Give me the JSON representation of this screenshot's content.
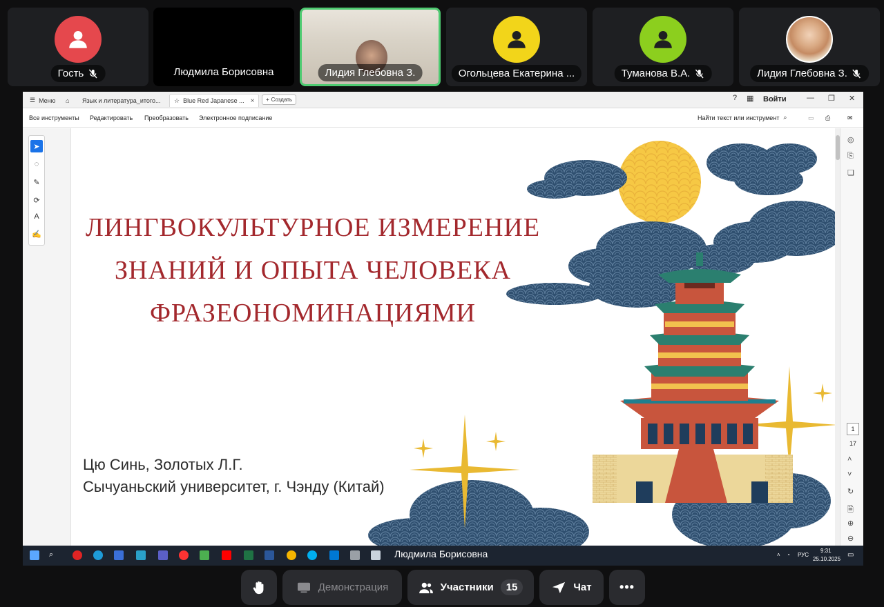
{
  "participants": [
    {
      "name": "Гость",
      "muted": true,
      "avatar": "person-icon",
      "color": "#e5484d"
    },
    {
      "name": "Людмила Борисовна",
      "muted": false,
      "avatar": "none",
      "color": "#000000"
    },
    {
      "name": "Лидия Глебовна З.",
      "muted": false,
      "avatar": "camera-video",
      "active": true
    },
    {
      "name": "Огольцева Екатерина ...",
      "muted": false,
      "avatar": "person-icon",
      "color": "#f2d51a"
    },
    {
      "name": "Туманова В.А.",
      "muted": true,
      "avatar": "person-icon",
      "color": "#8ccf1e"
    },
    {
      "name": "Лидия Глебовна З.",
      "muted": true,
      "avatar": "photo"
    }
  ],
  "browser": {
    "menu": "Меню",
    "tabs": [
      {
        "label": "Язык и литература_итого..."
      },
      {
        "label": "Blue Red Japanese ..."
      }
    ],
    "new_tab": "Создать",
    "login": "Войти",
    "toolbar": {
      "all_tools": "Все инструменты",
      "edit": "Редактировать",
      "convert": "Преобразовать",
      "sign": "Электронное подписание",
      "search": "Найти текст или инструмент"
    },
    "page": {
      "current": "1",
      "total": "17"
    }
  },
  "slide": {
    "title_lines": [
      "ЛИНГВОКУЛЬТУРНОЕ ИЗМЕРЕНИЕ",
      "ЗНАНИЙ И ОПЫТА ЧЕЛОВЕКА",
      "ФРАЗЕОНОМИНАЦИЯМИ"
    ],
    "authors": "Цю Синь, Золотых Л.Г.",
    "affiliation": "Сычуаньский университет, г. Чэнду (Китай)",
    "colors": {
      "title": "#a3282d",
      "cloud": "#2f4f6f",
      "sun": "#f6c844",
      "gold": "#e9b932"
    }
  },
  "taskbar": {
    "speaker": "Людмила Борисовна",
    "lang": "РУС",
    "time": "9:31",
    "date": "25.10.2025"
  },
  "controls": {
    "raise_hand": "raise-hand-icon",
    "demo": "Демонстрация",
    "participants": "Участники",
    "participants_count": "15",
    "chat": "Чат",
    "more": "•••"
  }
}
